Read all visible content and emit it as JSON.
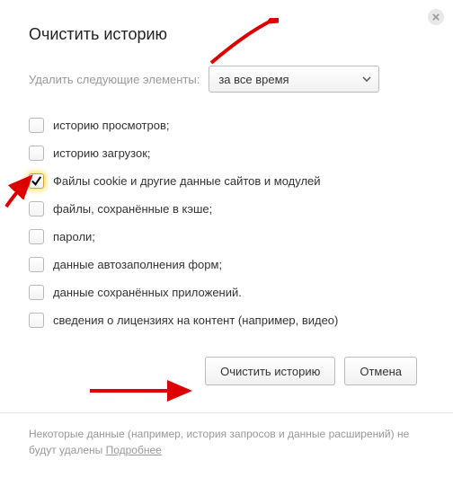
{
  "title": "Очистить историю",
  "period": {
    "label": "Удалить следующие элементы:",
    "selected": "за все время"
  },
  "options": [
    {
      "label": "историю просмотров;",
      "checked": false
    },
    {
      "label": "историю загрузок;",
      "checked": false
    },
    {
      "label": "Файлы cookie и другие данные сайтов и модулей",
      "checked": true
    },
    {
      "label": "файлы, сохранённые в кэше;",
      "checked": false
    },
    {
      "label": "пароли;",
      "checked": false
    },
    {
      "label": "данные автозаполнения форм;",
      "checked": false
    },
    {
      "label": "данные сохранённых приложений.",
      "checked": false
    },
    {
      "label": "сведения о лицензиях на контент (например, видео)",
      "checked": false
    }
  ],
  "buttons": {
    "clear": "Очистить историю",
    "cancel": "Отмена"
  },
  "footnote": {
    "text": "Некоторые данные (например, история запросов и данные расширений) не будут удалены ",
    "link": "Подробнее"
  }
}
